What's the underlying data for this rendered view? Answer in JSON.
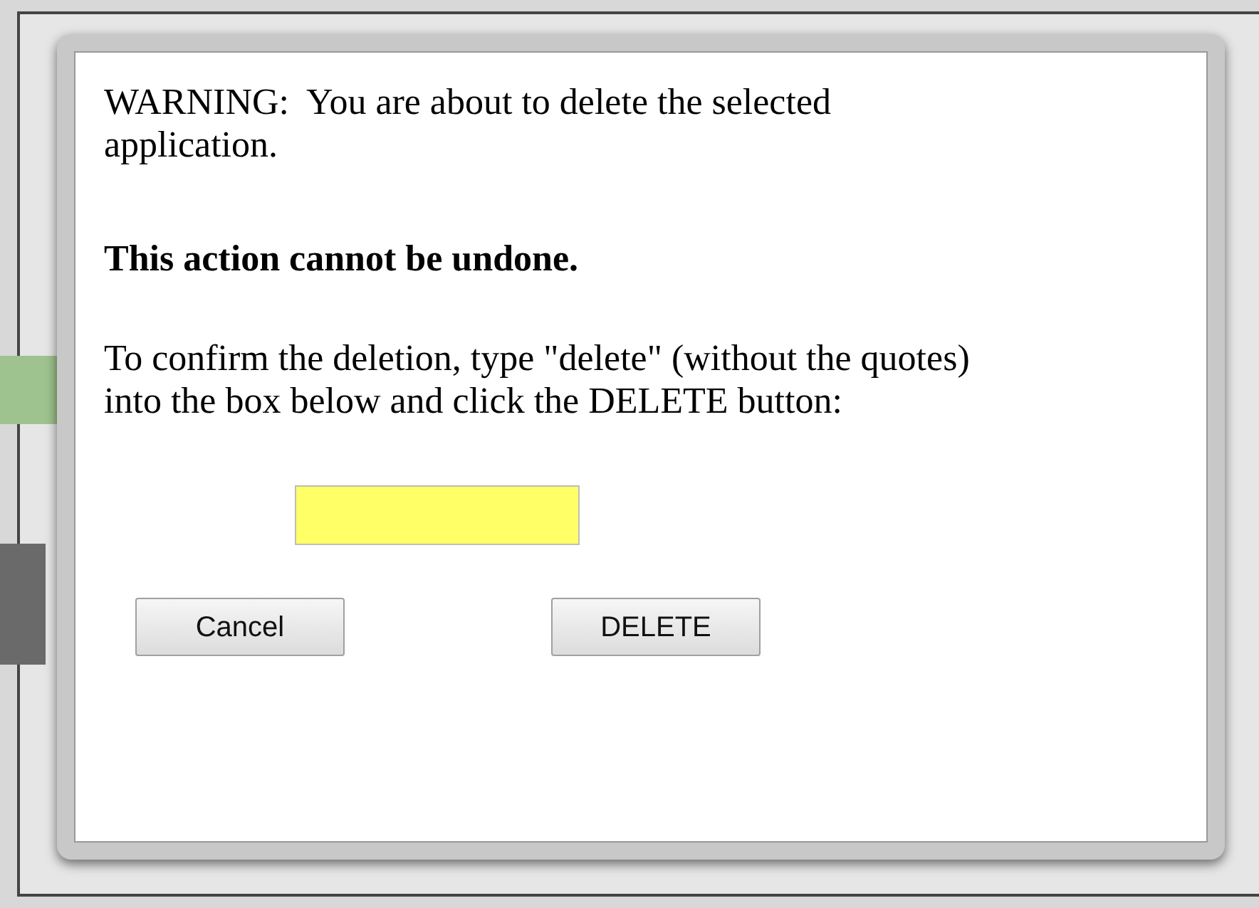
{
  "dialog": {
    "warning": "WARNING:  You are about to delete the selected application.",
    "emphasis": "This action cannot be undone.",
    "instructions": "To confirm the deletion, type \"delete\" (without the quotes) into the box below and click the DELETE button:",
    "buttons": [
      {
        "label": "Cancel",
        "kind": "cancel"
      },
      {
        "label": "DELETE",
        "kind": "delete"
      }
    ]
  }
}
